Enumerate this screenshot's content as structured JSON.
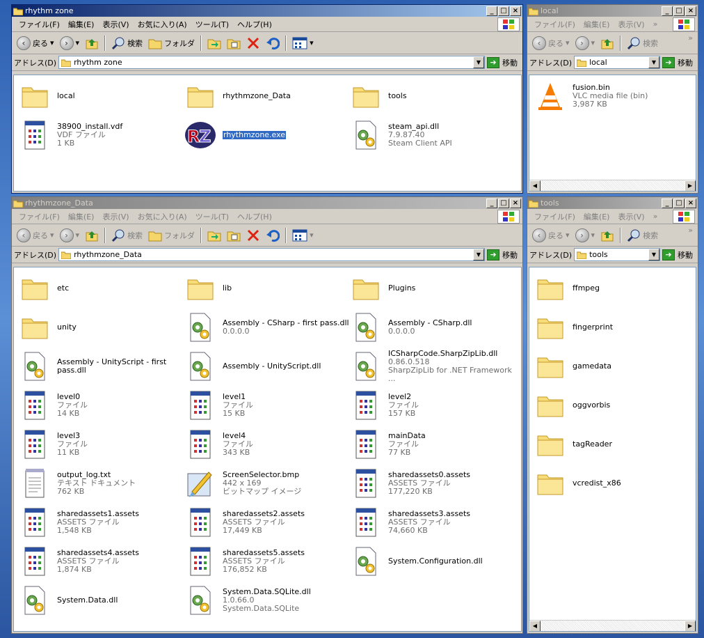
{
  "menus": [
    "ファイル(F)",
    "編集(E)",
    "表示(V)",
    "お気に入り(A)",
    "ツール(T)",
    "ヘルプ(H)"
  ],
  "menus_narrow": [
    "ファイル(F)",
    "編集(E)",
    "表示(V)"
  ],
  "toolbar": {
    "back": "戻る",
    "search": "検索",
    "folders": "フォルダ"
  },
  "addr_label": "アドレス(D)",
  "go_label": "移動",
  "chevron": "»",
  "win_main": {
    "title": "rhythm zone",
    "address": "rhythm zone",
    "items": [
      {
        "icon": "folder",
        "name": "local",
        "sub1": "",
        "sub2": ""
      },
      {
        "icon": "folder",
        "name": "rhythmzone_Data",
        "sub1": "",
        "sub2": ""
      },
      {
        "icon": "folder",
        "name": "tools",
        "sub1": "",
        "sub2": ""
      },
      {
        "icon": "file",
        "name": "38900_install.vdf",
        "sub1": "VDF ファイル",
        "sub2": "1 KB"
      },
      {
        "icon": "rz",
        "name": "rhythmzone.exe",
        "sub1": "",
        "sub2": "",
        "selected": true
      },
      {
        "icon": "dll",
        "name": "steam_api.dll",
        "sub1": "7.9.87.40",
        "sub2": "Steam Client API"
      }
    ]
  },
  "win_local": {
    "title": "local",
    "address": "local",
    "items": [
      {
        "icon": "vlc",
        "name": "fusion.bin",
        "sub1": "VLC media file (bin)",
        "sub2": "3,987 KB"
      }
    ]
  },
  "win_data": {
    "title": "rhythmzone_Data",
    "address": "rhythmzone_Data",
    "items": [
      {
        "icon": "folder",
        "name": "etc",
        "sub1": "",
        "sub2": ""
      },
      {
        "icon": "folder",
        "name": "lib",
        "sub1": "",
        "sub2": ""
      },
      {
        "icon": "folder",
        "name": "Plugins",
        "sub1": "",
        "sub2": ""
      },
      {
        "icon": "folder",
        "name": "unity",
        "sub1": "",
        "sub2": ""
      },
      {
        "icon": "dll",
        "name": "Assembly - CSharp - first pass.dll",
        "sub1": "0.0.0.0",
        "sub2": ""
      },
      {
        "icon": "dll",
        "name": "Assembly - CSharp.dll",
        "sub1": "0.0.0.0",
        "sub2": ""
      },
      {
        "icon": "dll",
        "name": "Assembly - UnityScript - first pass.dll",
        "sub1": "",
        "sub2": ""
      },
      {
        "icon": "dll",
        "name": "Assembly - UnityScript.dll",
        "sub1": "",
        "sub2": ""
      },
      {
        "icon": "dll",
        "name": "ICSharpCode.SharpZipLib.dll",
        "sub1": "0.86.0.518",
        "sub2": "SharpZipLib for .NET Framework ..."
      },
      {
        "icon": "file",
        "name": "level0",
        "sub1": "ファイル",
        "sub2": "14 KB"
      },
      {
        "icon": "file",
        "name": "level1",
        "sub1": "ファイル",
        "sub2": "15 KB"
      },
      {
        "icon": "file",
        "name": "level2",
        "sub1": "ファイル",
        "sub2": "157 KB"
      },
      {
        "icon": "file",
        "name": "level3",
        "sub1": "ファイル",
        "sub2": "11 KB"
      },
      {
        "icon": "file",
        "name": "level4",
        "sub1": "ファイル",
        "sub2": "343 KB"
      },
      {
        "icon": "file",
        "name": "mainData",
        "sub1": "ファイル",
        "sub2": "77 KB"
      },
      {
        "icon": "txt",
        "name": "output_log.txt",
        "sub1": "テキスト ドキュメント",
        "sub2": "762 KB"
      },
      {
        "icon": "bmp",
        "name": "ScreenSelector.bmp",
        "sub1": "442 x 169",
        "sub2": "ビットマップ イメージ"
      },
      {
        "icon": "file",
        "name": "sharedassets0.assets",
        "sub1": "ASSETS ファイル",
        "sub2": "177,220 KB"
      },
      {
        "icon": "file",
        "name": "sharedassets1.assets",
        "sub1": "ASSETS ファイル",
        "sub2": "1,548 KB"
      },
      {
        "icon": "file",
        "name": "sharedassets2.assets",
        "sub1": "ASSETS ファイル",
        "sub2": "17,449 KB"
      },
      {
        "icon": "file",
        "name": "sharedassets3.assets",
        "sub1": "ASSETS ファイル",
        "sub2": "74,660 KB"
      },
      {
        "icon": "file",
        "name": "sharedassets4.assets",
        "sub1": "ASSETS ファイル",
        "sub2": "1,874 KB"
      },
      {
        "icon": "file",
        "name": "sharedassets5.assets",
        "sub1": "ASSETS ファイル",
        "sub2": "176,852 KB"
      },
      {
        "icon": "dll",
        "name": "System.Configuration.dll",
        "sub1": "",
        "sub2": ""
      },
      {
        "icon": "dll",
        "name": "System.Data.dll",
        "sub1": "",
        "sub2": ""
      },
      {
        "icon": "dll",
        "name": "System.Data.SQLite.dll",
        "sub1": "1.0.66.0",
        "sub2": "System.Data.SQLite"
      }
    ]
  },
  "win_tools": {
    "title": "tools",
    "address": "tools",
    "items": [
      {
        "icon": "folder",
        "name": "ffmpeg",
        "sub1": "",
        "sub2": ""
      },
      {
        "icon": "folder",
        "name": "fingerprint",
        "sub1": "",
        "sub2": ""
      },
      {
        "icon": "folder",
        "name": "gamedata",
        "sub1": "",
        "sub2": ""
      },
      {
        "icon": "folder",
        "name": "oggvorbis",
        "sub1": "",
        "sub2": ""
      },
      {
        "icon": "folder",
        "name": "tagReader",
        "sub1": "",
        "sub2": ""
      },
      {
        "icon": "folder",
        "name": "vcredist_x86",
        "sub1": "",
        "sub2": ""
      }
    ]
  }
}
